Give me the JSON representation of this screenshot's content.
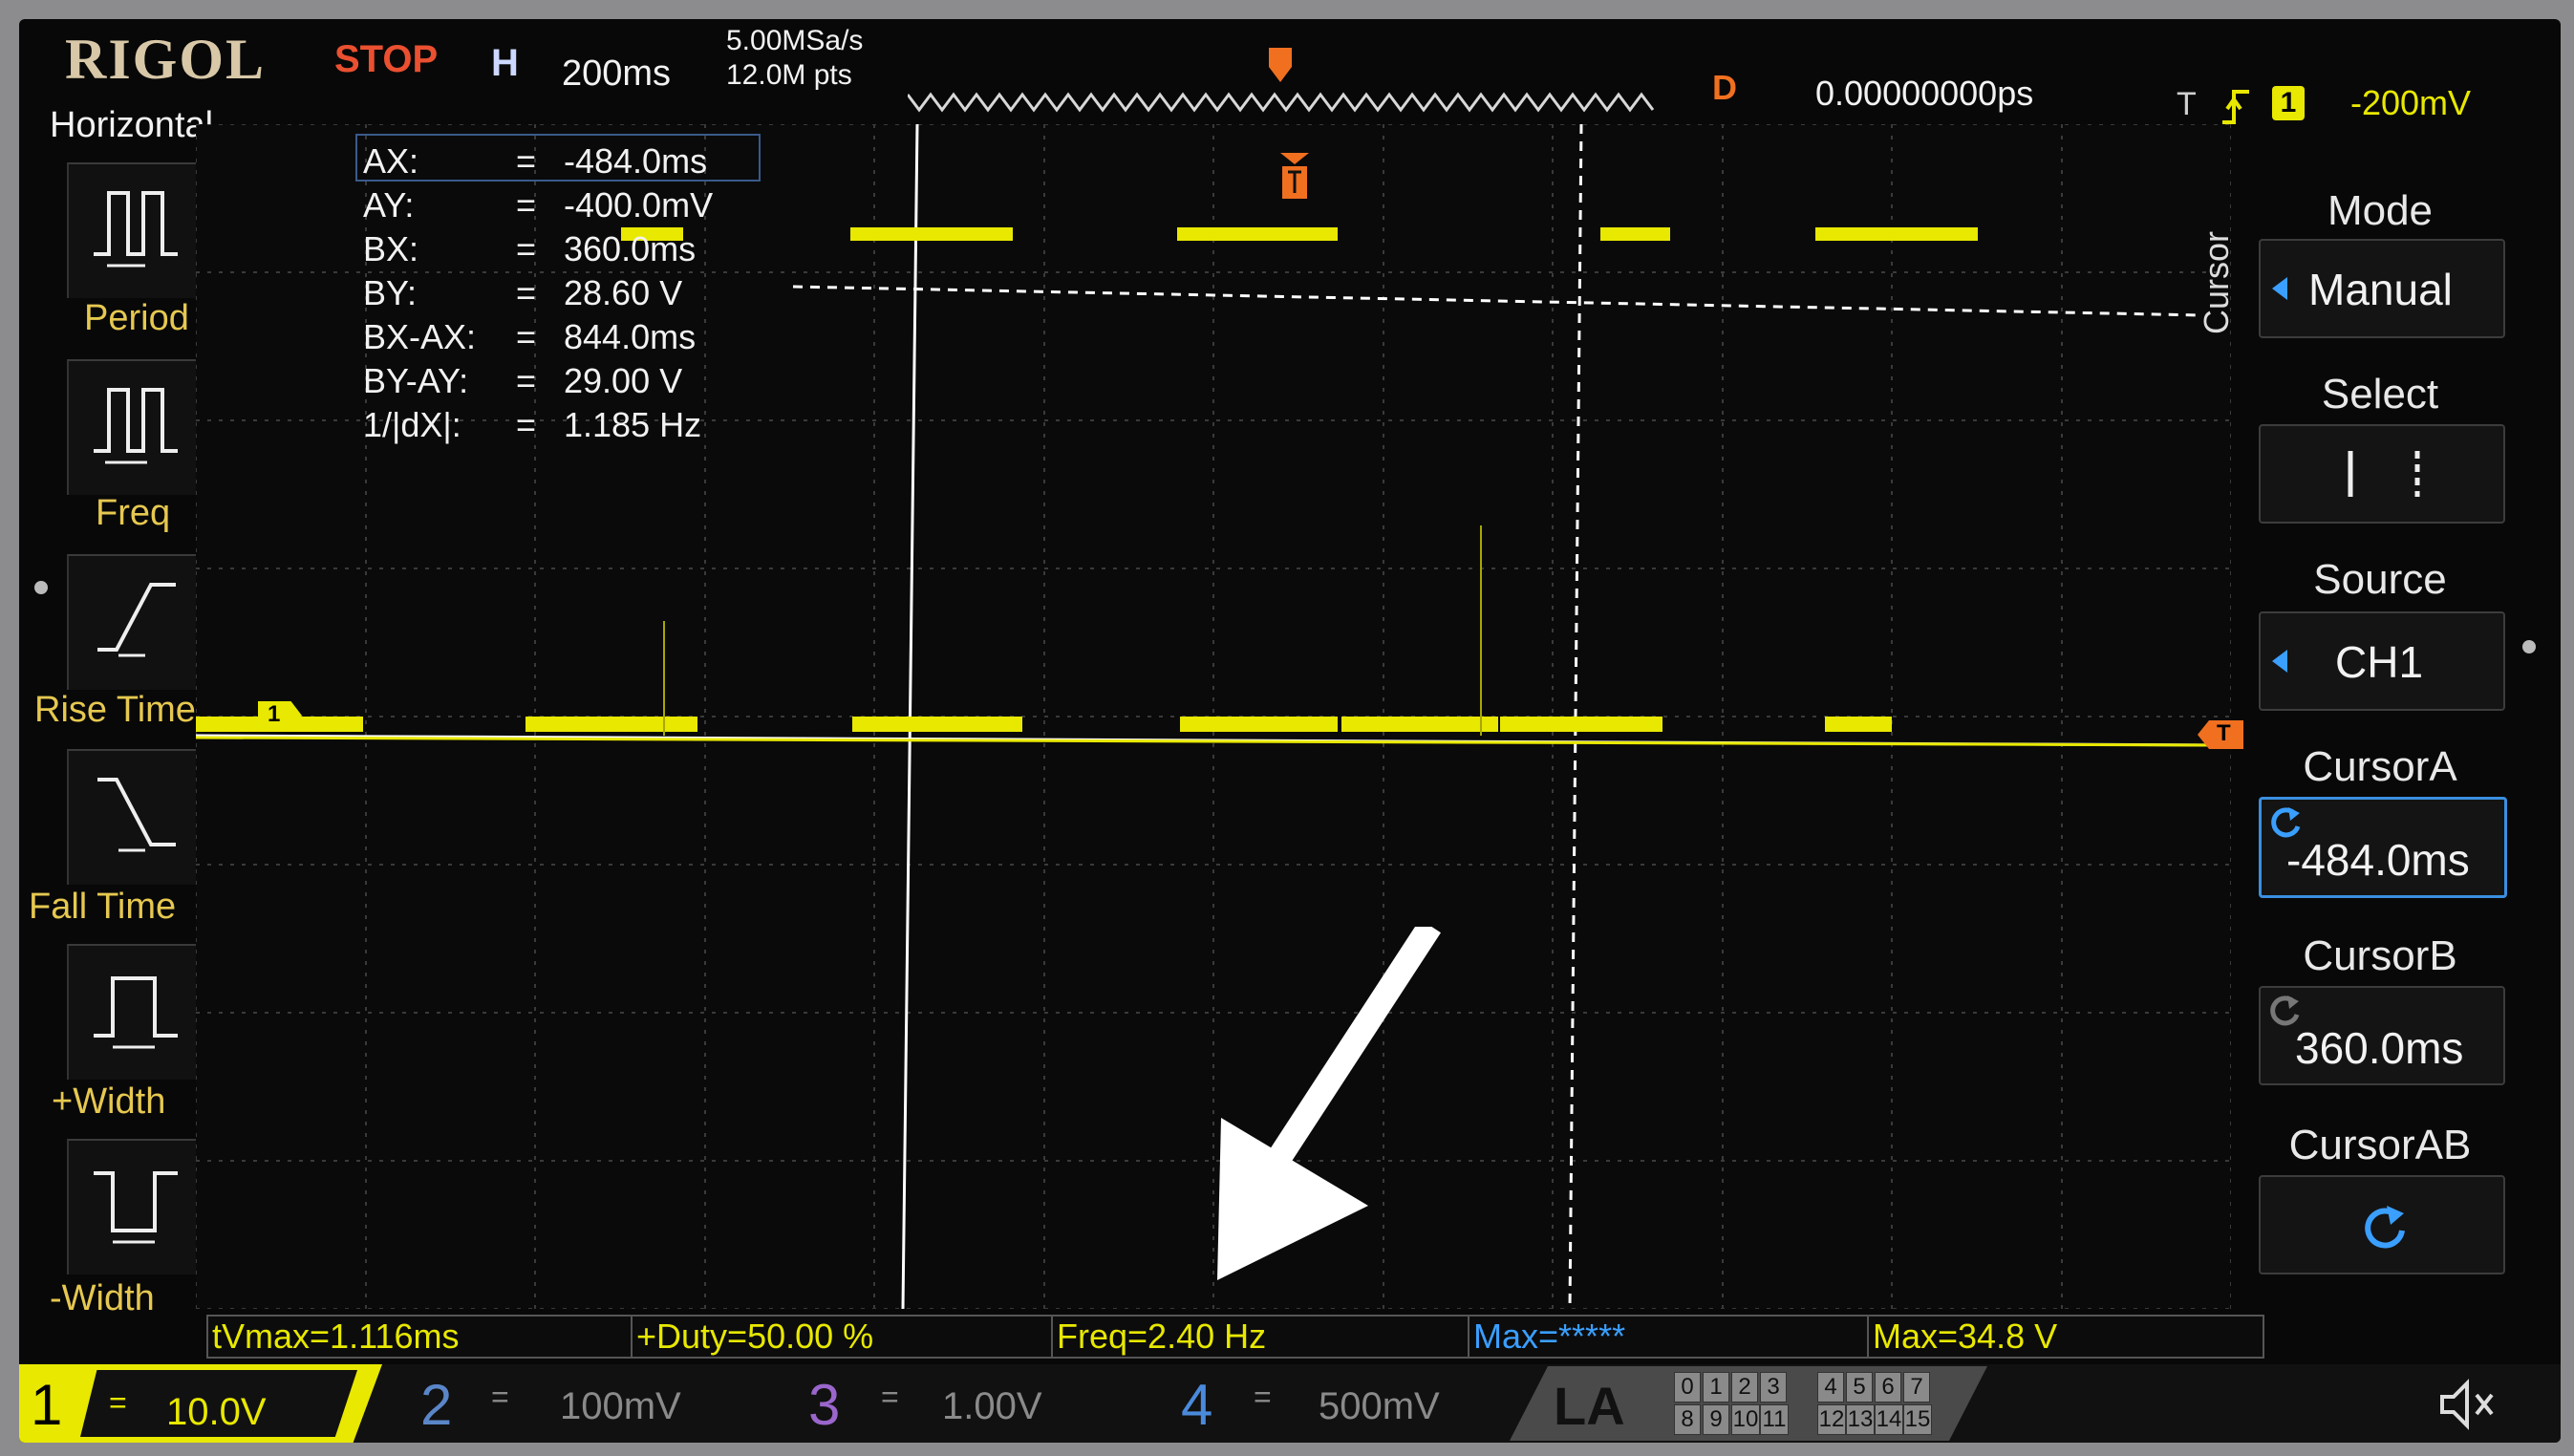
{
  "header": {
    "brand": "RIGOL",
    "run_state": "STOP",
    "timebase_label": "H",
    "timebase": "200ms",
    "sample_rate": "5.00MSa/s",
    "memory_depth": "12.0M pts",
    "delay_label": "D",
    "delay": "0.00000000ps",
    "trigger_channel": "1",
    "trigger_level": "-200mV"
  },
  "left_menu": {
    "title": "Horizontal",
    "items": [
      {
        "label": "Period"
      },
      {
        "label": "Freq"
      },
      {
        "label": "Rise Time"
      },
      {
        "label": "Fall Time"
      },
      {
        "label": "+Width"
      },
      {
        "label": "-Width"
      }
    ]
  },
  "cursor_readout": [
    {
      "key": "AX:",
      "eq": "=",
      "value": "-484.0ms"
    },
    {
      "key": "AY:",
      "eq": "=",
      "value": "-400.0mV"
    },
    {
      "key": "BX:",
      "eq": "=",
      "value": "360.0ms"
    },
    {
      "key": "BY:",
      "eq": "=",
      "value": "28.60 V"
    },
    {
      "key": "BX-AX:",
      "eq": "=",
      "value": "844.0ms"
    },
    {
      "key": "BY-AY:",
      "eq": "=",
      "value": "29.00 V"
    },
    {
      "key": "1/|dX|:",
      "eq": "=",
      "value": "1.185 Hz"
    }
  ],
  "right_menu": {
    "vertical_title": "Cursor",
    "mode": {
      "label": "Mode",
      "value": "Manual"
    },
    "select": {
      "label": "Select"
    },
    "source": {
      "label": "Source",
      "value": "CH1"
    },
    "cursor_a": {
      "label": "CursorA",
      "value": "-484.0ms"
    },
    "cursor_b": {
      "label": "CursorB",
      "value": "360.0ms"
    },
    "cursor_ab": {
      "label": "CursorAB"
    }
  },
  "measurements": [
    {
      "text": "tVmax=1.116ms"
    },
    {
      "text": "+Duty=50.00 %"
    },
    {
      "text": "Freq=2.40 Hz"
    },
    {
      "text": "Max=*****"
    },
    {
      "text": "Max=34.8 V"
    }
  ],
  "channels": [
    {
      "num": "1",
      "coupling": "=",
      "scale": "10.0V",
      "active": true
    },
    {
      "num": "2",
      "coupling": "=",
      "scale": "100mV",
      "active": false
    },
    {
      "num": "3",
      "coupling": "=",
      "scale": "1.00V",
      "active": false
    },
    {
      "num": "4",
      "coupling": "=",
      "scale": "500mV",
      "active": false
    }
  ],
  "la": {
    "label": "LA",
    "row1": [
      "0",
      "1",
      "2",
      "3",
      "4",
      "5",
      "6",
      "7"
    ],
    "row2": [
      "8",
      "9",
      "10",
      "11",
      "12",
      "13",
      "14",
      "15"
    ]
  },
  "markers": {
    "ch1_marker": "1",
    "trigger_marker": "T"
  },
  "colors": {
    "trace": "#e8e800",
    "brand": "#d8c8a8",
    "stop": "#ea5030",
    "accent_orange": "#f07020",
    "cursor_line": "#ffffff"
  },
  "icons": {
    "trigger_edge": "rising-edge-icon",
    "speaker": "mute-speaker-icon",
    "knob": "rotate-knob-icon",
    "menu_arrow": "left-arrow-icon"
  }
}
